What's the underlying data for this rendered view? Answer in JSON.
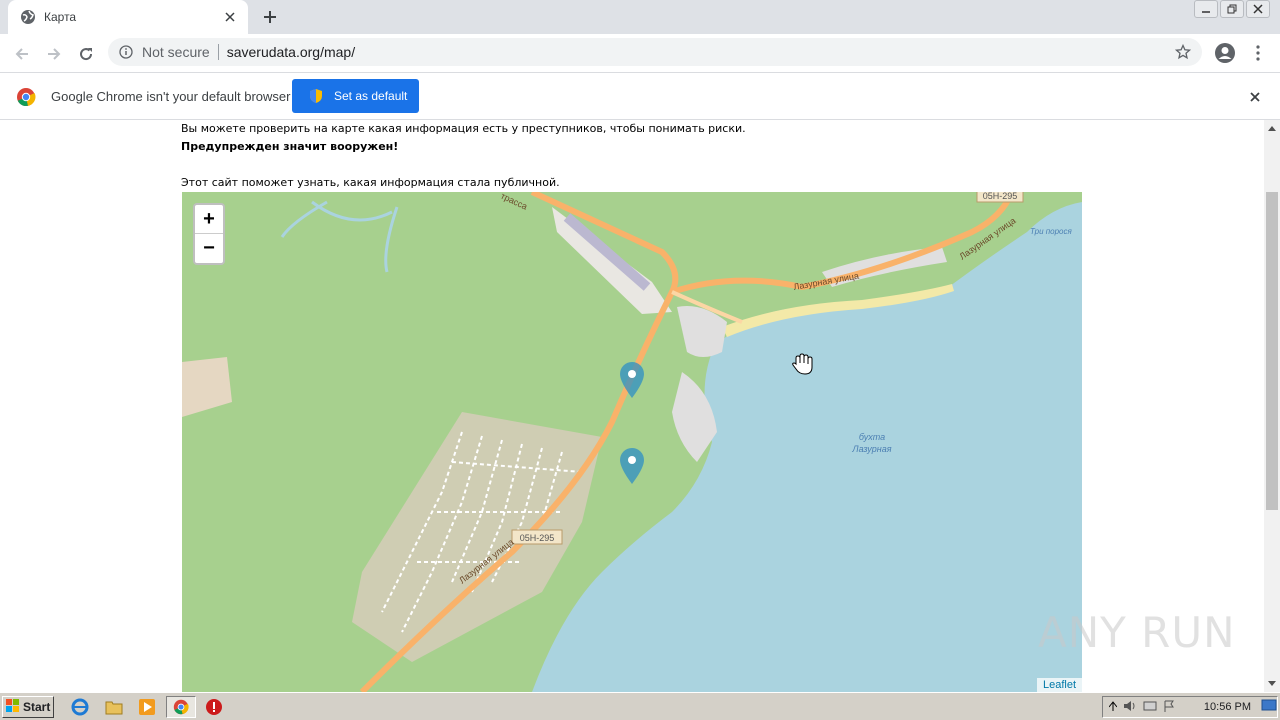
{
  "browser": {
    "tab_title": "Карта",
    "not_secure": "Not secure",
    "url": "saverudata.org/map/",
    "infobar_message": "Google Chrome isn't your default browser",
    "set_default_label": "Set as default"
  },
  "page": {
    "line1": "Вы можете проверить на карте какая информация есть у преступников, чтобы понимать риски.",
    "line2": "Предупрежден значит вооружен!",
    "line3": "Этот сайт поможет узнать, какая информация стала публичной."
  },
  "map": {
    "zoom_in": "+",
    "zoom_out": "−",
    "attribution": "Leaflet",
    "labels": {
      "route_top": "05H-295",
      "route_mid": "05H-295",
      "street_main": "Лазурная улица",
      "street_coast": "Лазурная улица",
      "street_right": "Лазурная улица",
      "highway": "трасса",
      "bay_line1": "бухта",
      "bay_line2": "Лазурная",
      "place_right": "Три порося"
    },
    "marker_count": 2
  },
  "taskbar": {
    "start_label": "Start",
    "clock": "10:56 PM"
  },
  "watermark": "ANY RUN"
}
